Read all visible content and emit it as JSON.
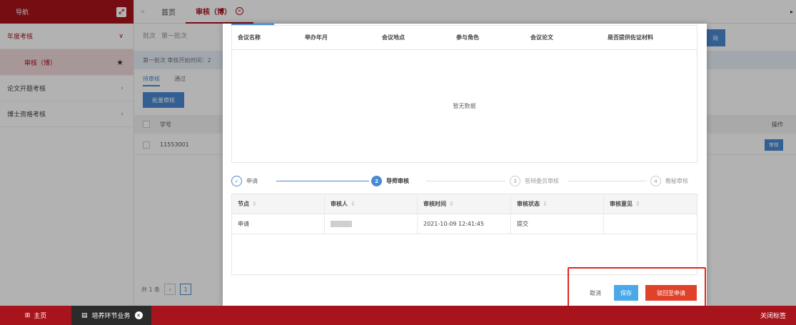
{
  "sidebar": {
    "title": "导航",
    "expand_icon": "expand-icon",
    "items": [
      {
        "label": "年度考核",
        "arrow": "∨"
      },
      {
        "label": "审核（博）"
      },
      {
        "label": "论文开题考核",
        "arrow": "›"
      },
      {
        "label": "博士资格考核",
        "arrow": "›"
      }
    ]
  },
  "tabs": {
    "prev_icon": "«",
    "home": "首页",
    "active": "审核（博）",
    "right_icon": "▸"
  },
  "background_page": {
    "batch_label": "批次",
    "batch_value": "第一批次",
    "info_text": "第一批次 审核开始时间：2",
    "subtab_pending": "待审核",
    "subtab_passed": "通过",
    "batch_review_button": "批量审核",
    "col_student_id": "学号",
    "col_operation": "操作",
    "row_student_id": "11553001",
    "row_review_button": "审核",
    "right_button": "询",
    "pager_total": "共 1 条",
    "pager_prev": "‹",
    "pager_current": "1"
  },
  "modal": {
    "conference_table": {
      "columns": [
        "会议名称",
        "举办年月",
        "会议地点",
        "参与角色",
        "会议论文",
        "是否提供佐证材料"
      ],
      "empty_text": "暂无数据"
    },
    "steps": [
      {
        "label": "申请",
        "mark": "✓",
        "state": "done"
      },
      {
        "label": "导师审核",
        "mark": "2",
        "state": "current"
      },
      {
        "label": "答辩委员审核",
        "mark": "3",
        "state": "pending"
      },
      {
        "label": "教秘审核",
        "mark": "4",
        "state": "pending"
      }
    ],
    "history_table": {
      "columns": [
        "节点",
        "审核人",
        "审核时间",
        "审核状态",
        "审核意见"
      ],
      "sort_glyph": "⇕",
      "rows": [
        {
          "node": "申请",
          "time": "2021-10-09 12:41:45",
          "status": "提交",
          "opinion": ""
        }
      ]
    },
    "buttons": {
      "cancel": "取消",
      "save": "保存",
      "return": "驳回至申请"
    }
  },
  "bottombar": {
    "home": "主页",
    "task": "培养环节业务",
    "close_tabs": "关闭标签"
  },
  "colors": {
    "brand_red": "#a8141c",
    "primary_blue": "#4a8ad2",
    "save_blue": "#4aa8e8",
    "reject_red": "#e0412a",
    "annotation_red": "#e3271d"
  }
}
